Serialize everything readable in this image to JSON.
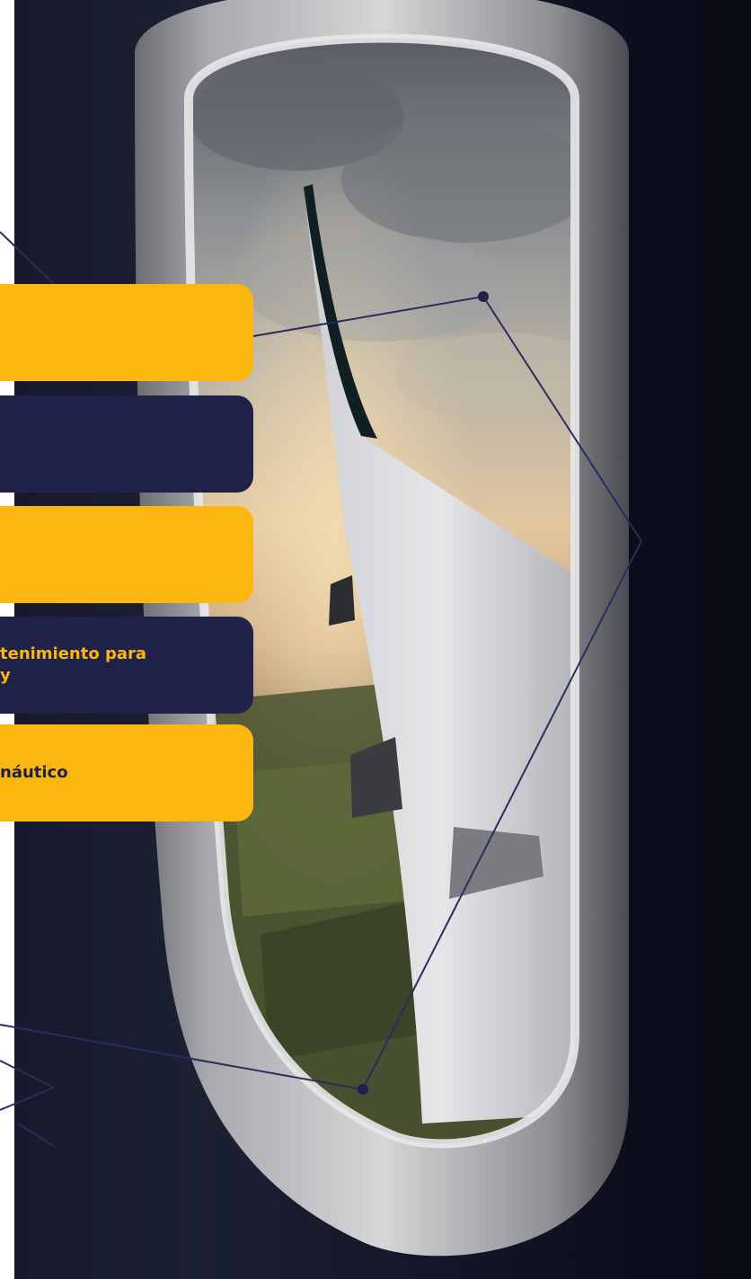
{
  "cards": [
    {
      "label": "",
      "color": "#fbb70f"
    },
    {
      "label": "",
      "color": "#1f2149"
    },
    {
      "label": "",
      "color": "#fbb70f"
    },
    {
      "label": "tenimiento para\ny",
      "color": "#1f2149"
    },
    {
      "label": "náutico",
      "color": "#fbb70f"
    }
  ],
  "colors": {
    "accent_yellow": "#fbb70f",
    "accent_navy": "#1f2149",
    "connector_line": "#2a2d5c"
  },
  "photo": {
    "subject": "airplane-window-view-icon"
  }
}
